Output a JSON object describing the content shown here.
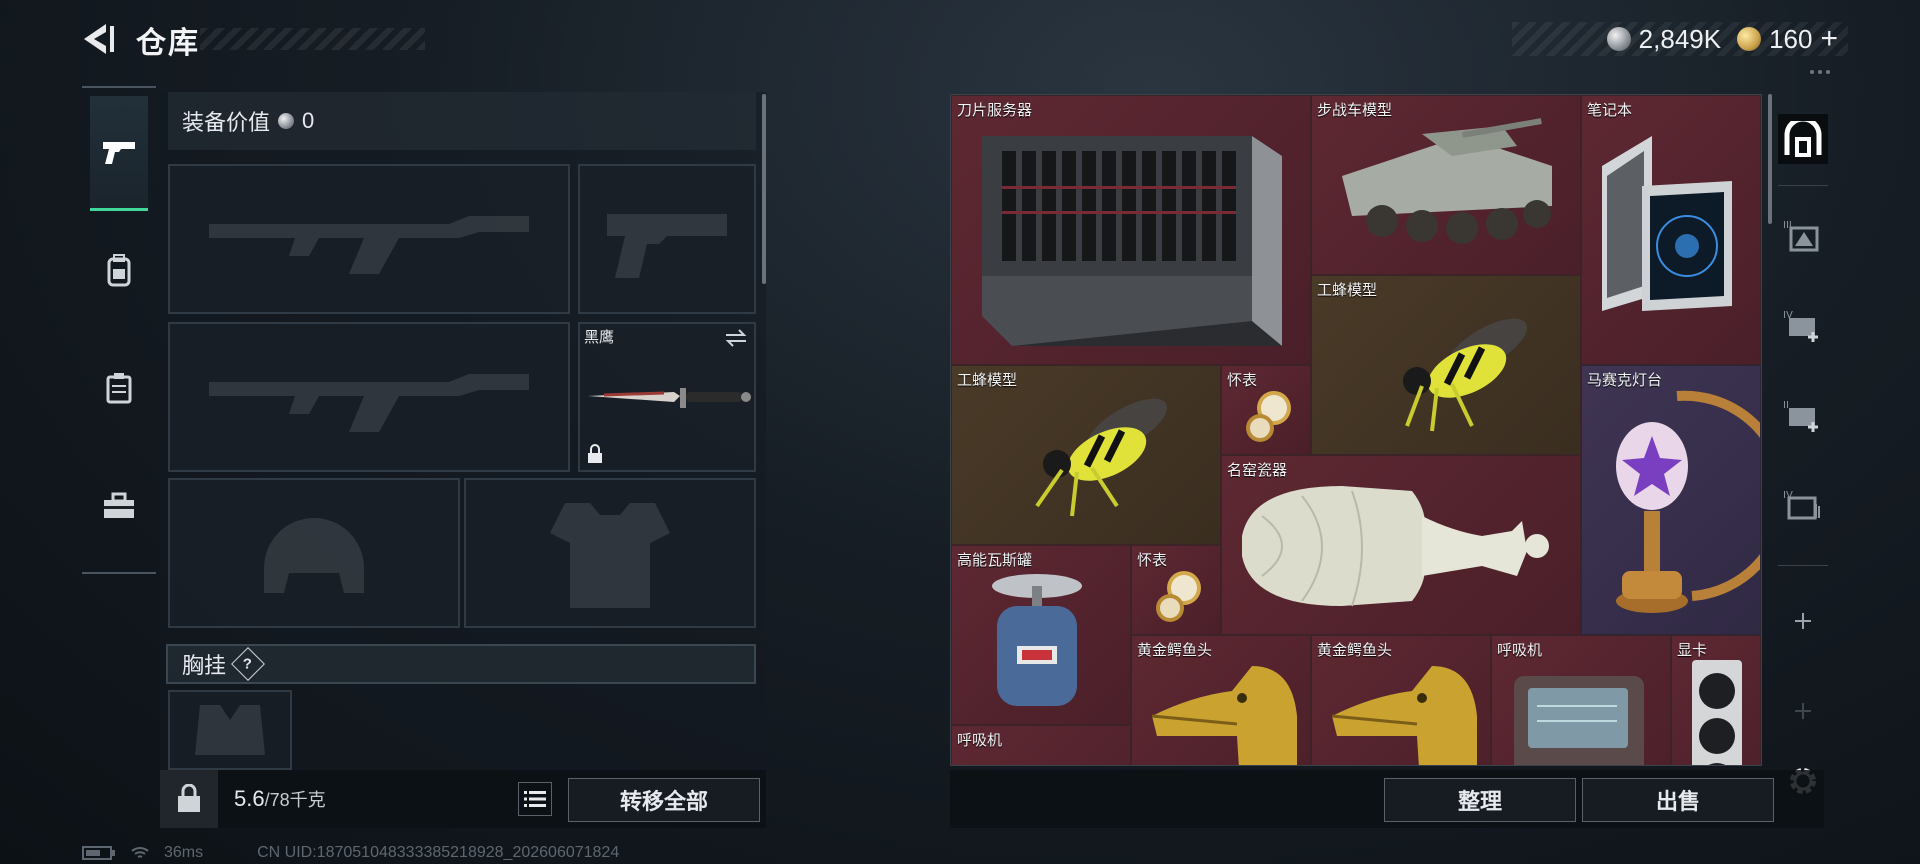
{
  "header": {
    "title": "仓库",
    "currencies": [
      {
        "icon": "silver-coin-icon",
        "value": "2,849K"
      },
      {
        "icon": "gold-coin-icon",
        "value": "160"
      }
    ],
    "add_label": "+"
  },
  "left_tabs": [
    {
      "icon": "pistol-icon",
      "active": true
    },
    {
      "icon": "backpack-icon",
      "active": false
    },
    {
      "icon": "vest-icon",
      "active": false
    },
    {
      "icon": "toolbox-icon",
      "active": false
    }
  ],
  "equipment": {
    "value_label": "装备价值",
    "value": "0",
    "melee_name": "黑鹰",
    "chest_label": "胸挂",
    "chest_help": "?"
  },
  "footer_left": {
    "weight_current": "5.6",
    "weight_max": "/78千克",
    "transfer_all": "转移全部"
  },
  "stash_items": [
    {
      "name": "刀片服务器",
      "color": "red"
    },
    {
      "name": "步战车模型",
      "color": "red"
    },
    {
      "name": "笔记本",
      "color": "red"
    },
    {
      "name": "工蜂模型",
      "color": "olive"
    },
    {
      "name": "工蜂模型",
      "color": "olive"
    },
    {
      "name": "怀表",
      "color": "red"
    },
    {
      "name": "马赛克灯台",
      "color": "purple"
    },
    {
      "name": "名窑瓷器",
      "color": "red"
    },
    {
      "name": "高能瓦斯罐",
      "color": "red"
    },
    {
      "name": "怀表",
      "color": "red"
    },
    {
      "name": "黄金鳄鱼头",
      "color": "red"
    },
    {
      "name": "黄金鳄鱼头",
      "color": "red"
    },
    {
      "name": "呼吸机",
      "color": "red"
    },
    {
      "name": "显卡",
      "color": "red"
    },
    {
      "name": "呼吸机",
      "color": "red"
    }
  ],
  "right_rail": {
    "icons": [
      "warehouse-icon",
      "tier-3-icon",
      "tier-4-add-icon",
      "tier-2-add-icon",
      "tier-4-folder-icon",
      "add-icon",
      "add-icon-disabled"
    ]
  },
  "footer_right": {
    "organize": "整理",
    "sell": "出售"
  },
  "status": {
    "ping": "36ms",
    "uid": "CN UID:187051048333385218928_202606071824"
  }
}
